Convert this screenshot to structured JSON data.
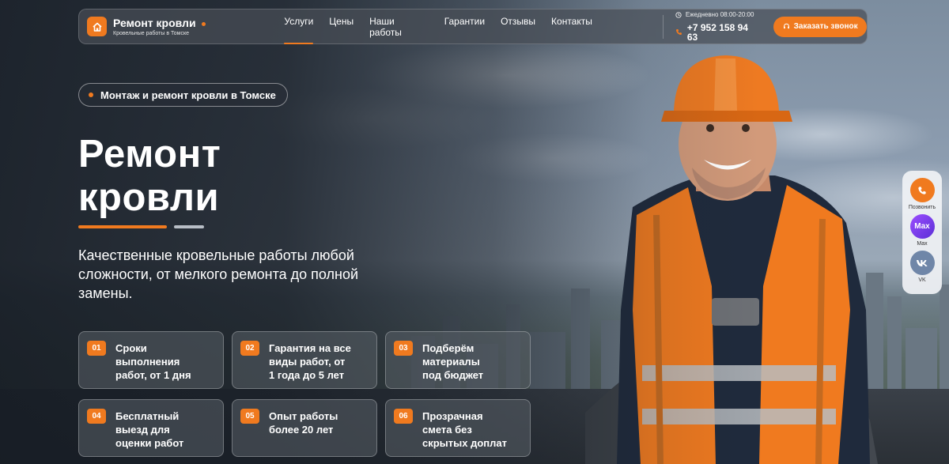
{
  "brand": {
    "title": "Ремонт кровли",
    "subtitle": "Кровельные работы в Томске"
  },
  "nav": [
    {
      "label": "Услуги",
      "active": true
    },
    {
      "label": "Цены"
    },
    {
      "label": "Наши работы"
    },
    {
      "label": "Гарантии"
    },
    {
      "label": "Отзывы"
    },
    {
      "label": "Контакты"
    }
  ],
  "contact": {
    "hours": "Ежедневно 08:00-20:00",
    "phone": "+7 952 158 94 63"
  },
  "callback_label": "Заказать звонок",
  "hero": {
    "pill": "Монтаж и ремонт кровли в Томске",
    "title_line1": "Ремонт",
    "title_line2": "кровли",
    "description": "Качественные кровельные работы любой сложности, от мелкого ремонта до полной замены."
  },
  "features": [
    {
      "num": "01",
      "text": "Сроки\nвыполнения\nработ, от 1 дня"
    },
    {
      "num": "02",
      "text": "Гарантия на все\nвиды работ, от\n1 года до 5 лет"
    },
    {
      "num": "03",
      "text": "Подберём\nматериалы\nпод бюджет"
    },
    {
      "num": "04",
      "text": "Бесплатный\nвыезд для\nоценки работ"
    },
    {
      "num": "05",
      "text": "Опыт работы\nболее 20 лет"
    },
    {
      "num": "06",
      "text": "Прозрачная\nсмета без\nскрытых доплат"
    }
  ],
  "social": [
    {
      "label": "Позвонить",
      "icon": "phone-icon",
      "color": "#f07a1f"
    },
    {
      "label": "Max",
      "icon_text": "Max",
      "color": "#7b3fe0"
    },
    {
      "label": "VK",
      "icon": "vk-icon",
      "color": "#6f86a8"
    }
  ],
  "colors": {
    "accent": "#f07a1f"
  }
}
